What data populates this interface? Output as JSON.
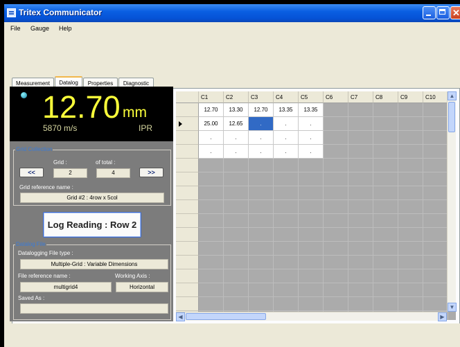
{
  "window": {
    "title": "Tritex Communicator"
  },
  "menu": [
    "File",
    "Gauge",
    "Help"
  ],
  "tabs": [
    "Measurement",
    "Datalog",
    "Properties",
    "Diagnostic"
  ],
  "active_tab": "Datalog",
  "readout": {
    "value": "12.70",
    "unit": "mm",
    "velocity": "5870 m/s",
    "mode": "IPR"
  },
  "grid_collection": {
    "title": "Grid Collection",
    "grid_label": "Grid :",
    "total_label": "of total :",
    "prev_label": "<<",
    "next_label": ">>",
    "grid_value": "2",
    "total_value": "4",
    "ref_label": "Grid reference name :",
    "ref_value": "Grid #2 : 4row x 5col"
  },
  "log_button": "Log Reading : Row 2",
  "datalog_file": {
    "title": "Datalog File",
    "type_label": "Datalogging File type :",
    "type_value": "Multiple-Grid : Variable Dimensions",
    "ref_label": "File reference name :",
    "axis_label": "Working Axis :",
    "ref_value": "multigrid4",
    "axis_value": "Horizontal",
    "saved_label": "Saved As :",
    "saved_value": ""
  },
  "grid": {
    "columns": [
      "C1",
      "C2",
      "C3",
      "C4",
      "C5",
      "C6",
      "C7",
      "C8",
      "C9",
      "C10"
    ],
    "rows": [
      [
        "12.70",
        "13.30",
        "12.70",
        "13.35",
        "13.35"
      ],
      [
        "25.00",
        "12.65",
        ".",
        ".",
        "."
      ],
      [
        ".",
        ".",
        ".",
        ".",
        "."
      ],
      [
        ".",
        ".",
        ".",
        ".",
        "."
      ]
    ],
    "current_row": 2,
    "selected_cell": "C3"
  },
  "colors": {
    "readout_text": "#fbff3a",
    "panel": "#7c7c7c",
    "selection": "#316ac5",
    "titlebar": "#0552d6"
  }
}
